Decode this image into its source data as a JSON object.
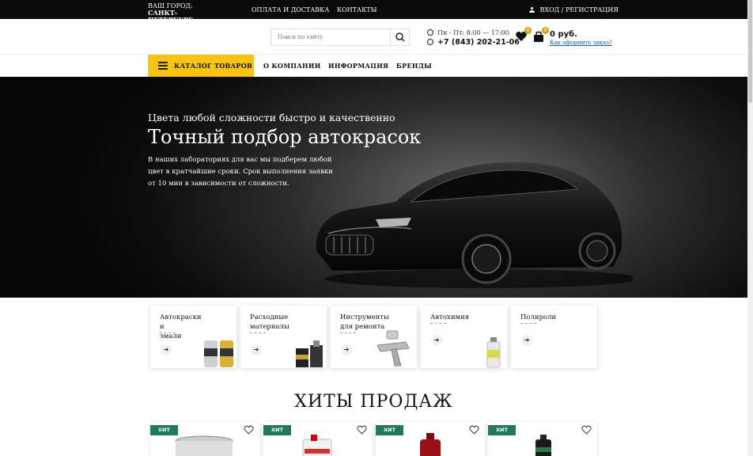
{
  "topbar": {
    "city_label": "ВАШ ГОРОД:",
    "city_name": "САНКТ-ПЕТЕРБУРГ",
    "links": [
      "ОПЛАТА И ДОСТАВКА",
      "КОНТАКТЫ"
    ],
    "login": "ВХОД",
    "separator": "/",
    "register": "РЕГИСТРАЦИЯ"
  },
  "header": {
    "search_placeholder": "Поиск по сайту",
    "hours": "Пн - Пт: 8:00 — 17:00",
    "phone": "+7 (843) 202-21-06",
    "favorites_count": "0",
    "cart_count": "0",
    "cart_sum": "0 руб.",
    "order_link": "Как оформить заказ?"
  },
  "nav": {
    "catalog": "КАТАЛОГ ТОВАРОВ",
    "items": [
      "О КОМПАНИИ",
      "ИНФОРМАЦИЯ",
      "БРЕНДЫ"
    ]
  },
  "hero": {
    "subtitle": "Цвета любой сложности быстро и качественно",
    "title": "Точный подбор автокрасок",
    "text_1": "В наших лабораториях для вас мы подберем любой цвет в",
    "text_2": "кратчайшие сроки. Срок выполнения заявки от",
    "text_num": "10",
    "text_3": "мин в",
    "text_4": "зависимости от сложности."
  },
  "categories": [
    {
      "line1": "Автокраски и",
      "line2": "эмали"
    },
    {
      "line1": "Расходные",
      "line2": "материалы"
    },
    {
      "line1": "Инструменты",
      "line2": "для ремонта"
    },
    {
      "line1": "Автохимия",
      "line2": ""
    },
    {
      "line1": "Полироли",
      "line2": ""
    }
  ],
  "hits": {
    "title": "ХИТЫ ПРОДАЖ",
    "badge": "ХИТ"
  },
  "colors": {
    "accent": "#f7c415",
    "topbar": "#0b0b0b",
    "hit_badge": "#1f7a55",
    "link": "#1b4f9c"
  }
}
